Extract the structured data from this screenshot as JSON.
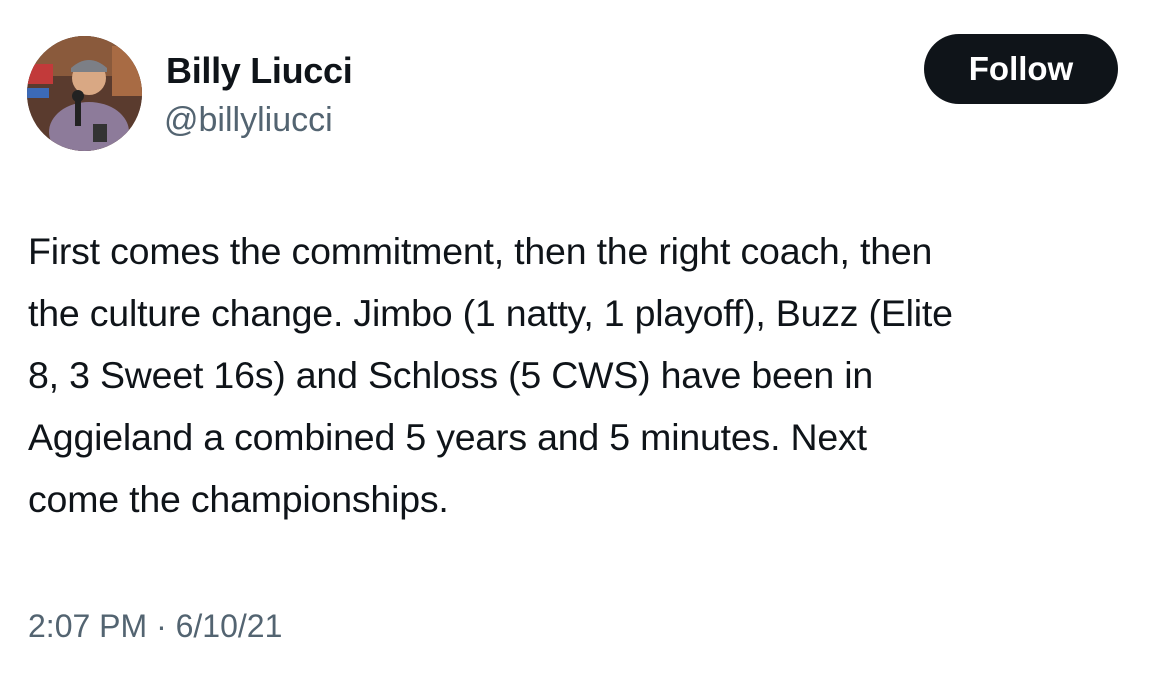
{
  "author": {
    "name": "Billy Liucci",
    "handle": "@billyliucci",
    "avatar": "avatar"
  },
  "actions": {
    "follow_label": "Follow"
  },
  "tweet": {
    "text": "First comes the commitment, then the right coach, then\nthe culture change. Jimbo (1 natty, 1 playoff), Buzz (Elite\n8, 3 Sweet 16s) and Schloss (5 CWS) have been in\nAggieland a combined 5 years and 5 minutes. Next\ncome the championships.",
    "time": "2:07 PM",
    "separator": "·",
    "date": "6/10/21"
  },
  "colors": {
    "text": "#0f1419",
    "secondary": "#536471",
    "button_bg": "#0f1419",
    "button_text": "#ffffff"
  }
}
